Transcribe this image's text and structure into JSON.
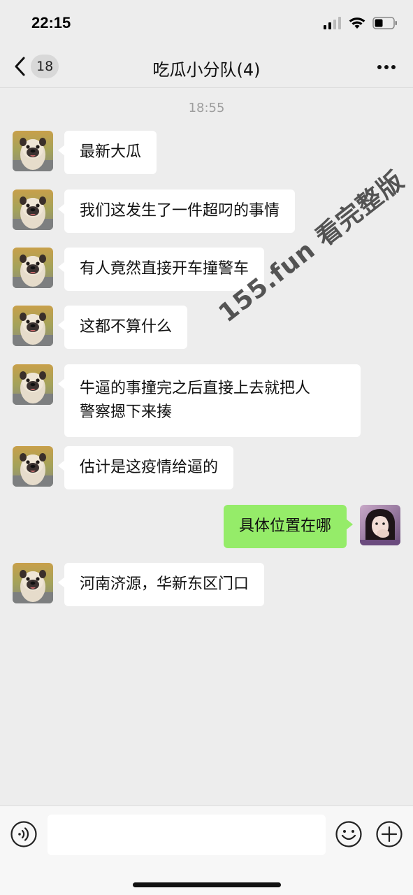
{
  "status_bar": {
    "time": "22:15"
  },
  "nav": {
    "back_count": "18",
    "title": "吃瓜小分队(4)"
  },
  "chat": {
    "timestamp": "18:55",
    "messages": [
      {
        "side": "in",
        "text": "最新大瓜"
      },
      {
        "side": "in",
        "text": "我们这发生了一件超叼的事情"
      },
      {
        "side": "in",
        "text": "有人竟然直接开车撞警车"
      },
      {
        "side": "in",
        "text": "这都不算什么"
      },
      {
        "side": "in",
        "line1": "牛逼的事撞完之后直接上去就把人",
        "line2": "警察摁下来揍"
      },
      {
        "side": "in",
        "text": "估计是这疫情给逼的"
      },
      {
        "side": "out",
        "text": "具体位置在哪"
      },
      {
        "side": "in",
        "text": "河南济源，华新东区门口"
      }
    ]
  },
  "watermark": {
    "text": "155.fun 看完整版"
  },
  "input_bar": {
    "message_value": ""
  },
  "colors": {
    "background": "#ededed",
    "incoming_bubble": "#ffffff",
    "outgoing_bubble": "#95ec69"
  }
}
